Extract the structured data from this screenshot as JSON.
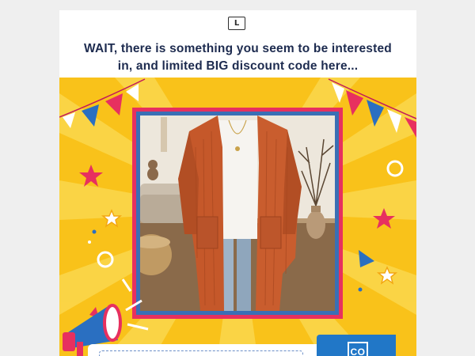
{
  "brand": {
    "logo_letter": "L"
  },
  "headline": {
    "line1": "WAIT, there is something you seem to be interested",
    "line2": "in, and limited BIG discount code here..."
  },
  "banner": {
    "product_image": "orange-long-cardigan-photo",
    "coupon_tab_text": "CO"
  },
  "colors": {
    "banner_yellow": "#f9c21a",
    "frame_pink": "#e7305f",
    "frame_blue": "#3a6fb5",
    "coupon_blue": "#2177c7",
    "headline_navy": "#1d2b4f"
  }
}
